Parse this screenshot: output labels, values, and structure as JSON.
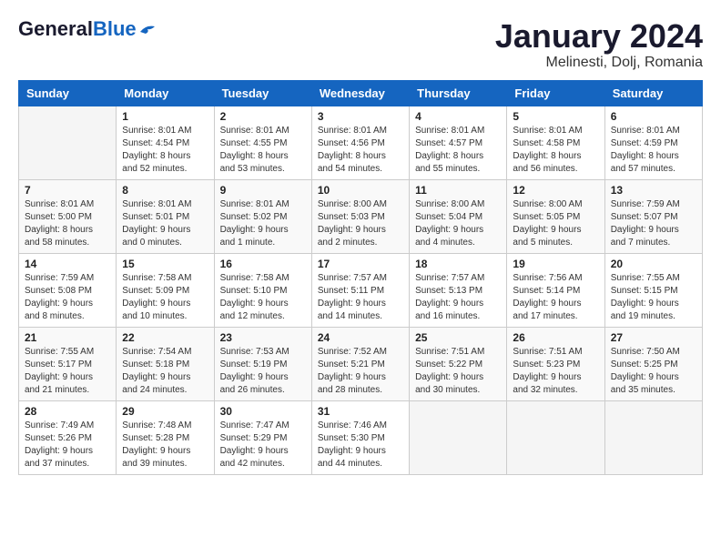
{
  "header": {
    "logo_general": "General",
    "logo_blue": "Blue",
    "month_title": "January 2024",
    "location": "Melinesti, Dolj, Romania"
  },
  "calendar": {
    "days_of_week": [
      "Sunday",
      "Monday",
      "Tuesday",
      "Wednesday",
      "Thursday",
      "Friday",
      "Saturday"
    ],
    "weeks": [
      [
        {
          "day": "",
          "info": ""
        },
        {
          "day": "1",
          "info": "Sunrise: 8:01 AM\nSunset: 4:54 PM\nDaylight: 8 hours\nand 52 minutes."
        },
        {
          "day": "2",
          "info": "Sunrise: 8:01 AM\nSunset: 4:55 PM\nDaylight: 8 hours\nand 53 minutes."
        },
        {
          "day": "3",
          "info": "Sunrise: 8:01 AM\nSunset: 4:56 PM\nDaylight: 8 hours\nand 54 minutes."
        },
        {
          "day": "4",
          "info": "Sunrise: 8:01 AM\nSunset: 4:57 PM\nDaylight: 8 hours\nand 55 minutes."
        },
        {
          "day": "5",
          "info": "Sunrise: 8:01 AM\nSunset: 4:58 PM\nDaylight: 8 hours\nand 56 minutes."
        },
        {
          "day": "6",
          "info": "Sunrise: 8:01 AM\nSunset: 4:59 PM\nDaylight: 8 hours\nand 57 minutes."
        }
      ],
      [
        {
          "day": "7",
          "info": "Sunrise: 8:01 AM\nSunset: 5:00 PM\nDaylight: 8 hours\nand 58 minutes."
        },
        {
          "day": "8",
          "info": "Sunrise: 8:01 AM\nSunset: 5:01 PM\nDaylight: 9 hours\nand 0 minutes."
        },
        {
          "day": "9",
          "info": "Sunrise: 8:01 AM\nSunset: 5:02 PM\nDaylight: 9 hours\nand 1 minute."
        },
        {
          "day": "10",
          "info": "Sunrise: 8:00 AM\nSunset: 5:03 PM\nDaylight: 9 hours\nand 2 minutes."
        },
        {
          "day": "11",
          "info": "Sunrise: 8:00 AM\nSunset: 5:04 PM\nDaylight: 9 hours\nand 4 minutes."
        },
        {
          "day": "12",
          "info": "Sunrise: 8:00 AM\nSunset: 5:05 PM\nDaylight: 9 hours\nand 5 minutes."
        },
        {
          "day": "13",
          "info": "Sunrise: 7:59 AM\nSunset: 5:07 PM\nDaylight: 9 hours\nand 7 minutes."
        }
      ],
      [
        {
          "day": "14",
          "info": "Sunrise: 7:59 AM\nSunset: 5:08 PM\nDaylight: 9 hours\nand 8 minutes."
        },
        {
          "day": "15",
          "info": "Sunrise: 7:58 AM\nSunset: 5:09 PM\nDaylight: 9 hours\nand 10 minutes."
        },
        {
          "day": "16",
          "info": "Sunrise: 7:58 AM\nSunset: 5:10 PM\nDaylight: 9 hours\nand 12 minutes."
        },
        {
          "day": "17",
          "info": "Sunrise: 7:57 AM\nSunset: 5:11 PM\nDaylight: 9 hours\nand 14 minutes."
        },
        {
          "day": "18",
          "info": "Sunrise: 7:57 AM\nSunset: 5:13 PM\nDaylight: 9 hours\nand 16 minutes."
        },
        {
          "day": "19",
          "info": "Sunrise: 7:56 AM\nSunset: 5:14 PM\nDaylight: 9 hours\nand 17 minutes."
        },
        {
          "day": "20",
          "info": "Sunrise: 7:55 AM\nSunset: 5:15 PM\nDaylight: 9 hours\nand 19 minutes."
        }
      ],
      [
        {
          "day": "21",
          "info": "Sunrise: 7:55 AM\nSunset: 5:17 PM\nDaylight: 9 hours\nand 21 minutes."
        },
        {
          "day": "22",
          "info": "Sunrise: 7:54 AM\nSunset: 5:18 PM\nDaylight: 9 hours\nand 24 minutes."
        },
        {
          "day": "23",
          "info": "Sunrise: 7:53 AM\nSunset: 5:19 PM\nDaylight: 9 hours\nand 26 minutes."
        },
        {
          "day": "24",
          "info": "Sunrise: 7:52 AM\nSunset: 5:21 PM\nDaylight: 9 hours\nand 28 minutes."
        },
        {
          "day": "25",
          "info": "Sunrise: 7:51 AM\nSunset: 5:22 PM\nDaylight: 9 hours\nand 30 minutes."
        },
        {
          "day": "26",
          "info": "Sunrise: 7:51 AM\nSunset: 5:23 PM\nDaylight: 9 hours\nand 32 minutes."
        },
        {
          "day": "27",
          "info": "Sunrise: 7:50 AM\nSunset: 5:25 PM\nDaylight: 9 hours\nand 35 minutes."
        }
      ],
      [
        {
          "day": "28",
          "info": "Sunrise: 7:49 AM\nSunset: 5:26 PM\nDaylight: 9 hours\nand 37 minutes."
        },
        {
          "day": "29",
          "info": "Sunrise: 7:48 AM\nSunset: 5:28 PM\nDaylight: 9 hours\nand 39 minutes."
        },
        {
          "day": "30",
          "info": "Sunrise: 7:47 AM\nSunset: 5:29 PM\nDaylight: 9 hours\nand 42 minutes."
        },
        {
          "day": "31",
          "info": "Sunrise: 7:46 AM\nSunset: 5:30 PM\nDaylight: 9 hours\nand 44 minutes."
        },
        {
          "day": "",
          "info": ""
        },
        {
          "day": "",
          "info": ""
        },
        {
          "day": "",
          "info": ""
        }
      ]
    ]
  }
}
